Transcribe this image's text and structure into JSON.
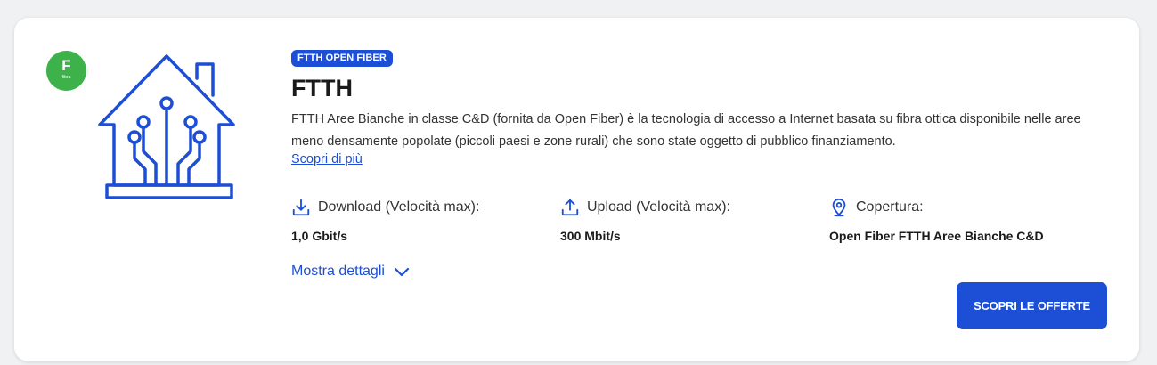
{
  "tech_badge": {
    "letter": "F",
    "sublabel": "fibra",
    "color": "#3db24a"
  },
  "tag": "FTTH OPEN FIBER",
  "title": "FTTH",
  "description": "FTTH Aree Bianche in classe C&D (fornita da Open Fiber) è la tecnologia di accesso a Internet basata su fibra ottica disponibile nelle aree meno densamente popolate (piccoli paesi e zone rurali) che sono state oggetto di pubblico finanziamento.",
  "learn_more": "Scopri di più",
  "specs": {
    "download": {
      "label": "Download (Velocità max):",
      "value": "1,0 Gbit/s",
      "icon": "download-icon"
    },
    "upload": {
      "label": "Upload (Velocità max):",
      "value": "300 Mbit/s",
      "icon": "upload-icon"
    },
    "coverage": {
      "label": "Copertura:",
      "value": "Open Fiber FTTH Aree Bianche C&D",
      "icon": "location-pin-icon"
    }
  },
  "details_toggle": "Mostra dettagli",
  "cta": "SCOPRI LE OFFERTE",
  "accent_color": "#1c4fd6"
}
